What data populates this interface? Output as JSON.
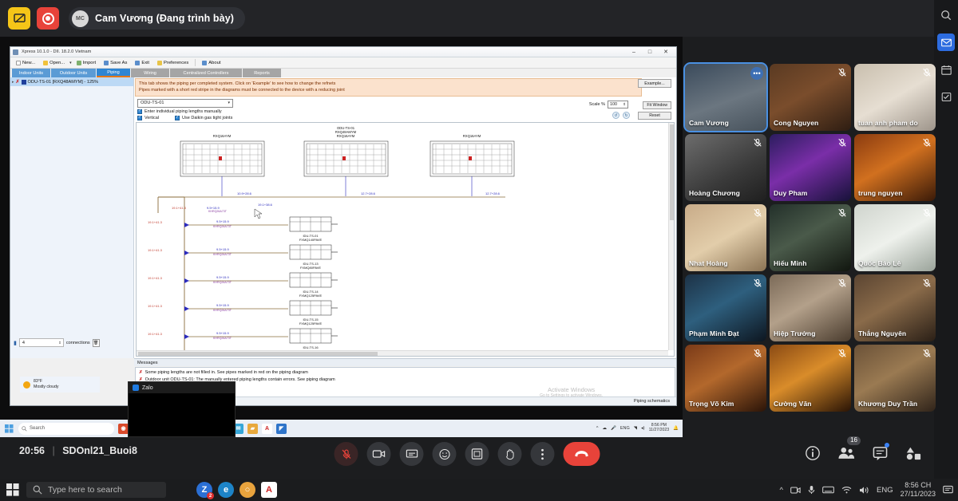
{
  "meeting": {
    "presenter_label": "Cam Vương (Đang trình bày)",
    "presenter_avatar": "MC",
    "share_icon": "screen-share-icon",
    "record_icon": "record-icon",
    "elapsed_time": "20:56",
    "room_name": "SDOnl21_Buoi8",
    "separator": "|",
    "participant_count": "16"
  },
  "controls": [
    {
      "name": "mic-toggle",
      "icon": "microphone-muted-icon"
    },
    {
      "name": "camera-toggle",
      "icon": "camera-icon"
    },
    {
      "name": "present-screen",
      "icon": "present-icon"
    },
    {
      "name": "reactions",
      "icon": "emoji-icon"
    },
    {
      "name": "layout",
      "icon": "layout-icon"
    },
    {
      "name": "raise-hand",
      "icon": "hand-icon"
    },
    {
      "name": "more-options",
      "icon": "more-vertical-icon"
    },
    {
      "name": "end-call",
      "icon": "phone-hangup-icon"
    }
  ],
  "right_controls": [
    {
      "name": "meeting-info",
      "icon": "info-icon"
    },
    {
      "name": "participants",
      "icon": "people-icon",
      "badge": "16"
    },
    {
      "name": "chat",
      "icon": "chat-icon",
      "dot": true
    },
    {
      "name": "apps",
      "icon": "shapes-icon"
    }
  ],
  "right_rail": [
    {
      "name": "search-icon"
    },
    {
      "name": "mail-icon"
    },
    {
      "name": "calendar-icon"
    },
    {
      "name": "tasks-icon"
    }
  ],
  "participants": [
    {
      "name": "Cam Vương",
      "muted": false,
      "speaking": true,
      "dots": true,
      "bg": "linear-gradient(160deg,#3b4b5c,#6b7680 55%,#47525c)"
    },
    {
      "name": "Cong Nguyen",
      "muted": true,
      "speaking": false,
      "dots": false,
      "bg": "linear-gradient(150deg,#5a3a22,#7a4d2c 45%,#2e1d12)"
    },
    {
      "name": "tuan anh pham do",
      "muted": true,
      "speaking": false,
      "dots": false,
      "bg": "linear-gradient(150deg,#c9bfae,#e6ded2 50%,#9d948a)"
    },
    {
      "name": "Hoàng Chương",
      "muted": true,
      "speaking": false,
      "dots": false,
      "bg": "linear-gradient(150deg,#6d6d6d,#3a3a3a 60%,#1f1f1f)"
    },
    {
      "name": "Duy Pham",
      "muted": true,
      "speaking": false,
      "dots": false,
      "bg": "linear-gradient(150deg,#2b1d5e,#7a2ea8 45%,#17123a)"
    },
    {
      "name": "trung nguyen",
      "muted": true,
      "speaking": false,
      "dots": false,
      "bg": "linear-gradient(150deg,#8a3b10,#d1701f 45%,#3a1a08)"
    },
    {
      "name": "Nhat Hoàng",
      "muted": true,
      "speaking": false,
      "dots": false,
      "bg": "linear-gradient(150deg,#c8ab88,#e2cdaa 50%,#8b7354)"
    },
    {
      "name": "Hiếu Minh",
      "muted": true,
      "speaking": false,
      "dots": false,
      "bg": "linear-gradient(150deg,#23302a,#4a5a4a 45%,#11160f)"
    },
    {
      "name": "Quốc Bảo Lê",
      "muted": true,
      "speaking": false,
      "dots": false,
      "bg": "linear-gradient(150deg,#cfd4cd,#eef1ec 50%,#9aa39a)"
    },
    {
      "name": "Phạm Minh Đạt",
      "muted": true,
      "speaking": false,
      "dots": false,
      "bg": "linear-gradient(150deg,#1d3246,#2e5f7e 45%,#0d1620)"
    },
    {
      "name": "Hiệp Trưởng",
      "muted": true,
      "speaking": false,
      "dots": false,
      "bg": "linear-gradient(150deg,#7b6a58,#b3a08a 45%,#4a3c2e)"
    },
    {
      "name": "Thắng Nguyên",
      "muted": true,
      "speaking": false,
      "dots": false,
      "bg": "linear-gradient(150deg,#5b4532,#8a6b4a 45%,#2a1f16)"
    },
    {
      "name": "Trọng Võ Kim",
      "muted": true,
      "speaking": false,
      "dots": false,
      "bg": "linear-gradient(150deg,#7a3a18,#b3682c 45%,#2b1408)"
    },
    {
      "name": "Cường Văn",
      "muted": true,
      "speaking": false,
      "dots": false,
      "bg": "linear-gradient(150deg,#8a4a14,#d98c2a 45%,#2a1405)"
    },
    {
      "name": "Khương Duy Trần",
      "muted": true,
      "speaking": false,
      "dots": false,
      "bg": "linear-gradient(150deg,#6b5238,#9a7a52 45%,#30241a)"
    }
  ],
  "shared_app": {
    "window_title": "Xpress 10.1.0 - DII. 18.2.0 Vietnam",
    "window_controls": {
      "minimize": "–",
      "maximize": "□",
      "close": "✕"
    },
    "toolbar": [
      {
        "label": "New...",
        "icon": "new-file-icon"
      },
      {
        "label": "Open...",
        "icon": "open-folder-icon"
      },
      {
        "label": "Import",
        "icon": "import-icon"
      },
      {
        "label": "Save As",
        "icon": "save-icon"
      },
      {
        "label": "Exit",
        "icon": "exit-icon"
      },
      {
        "label": "Preferences",
        "icon": "preferences-star-icon"
      },
      {
        "label": "About",
        "icon": "about-icon"
      }
    ],
    "tabs": [
      {
        "label": "Indoor Units",
        "active": false
      },
      {
        "label": "Outdoor Units",
        "active": false
      },
      {
        "label": "Piping",
        "active": true
      },
      {
        "label": "Wiring",
        "active": false,
        "gray": true
      },
      {
        "label": "Centralized Controllers",
        "active": false,
        "gray": true
      },
      {
        "label": "Reports",
        "active": false,
        "gray": true
      }
    ],
    "tree": {
      "item_label": "ODU-TS-01 [RXQ48AMYM] - 125%",
      "connections_value": "4",
      "connections_label": "connections",
      "delete_icon": "trash-icon"
    },
    "notice_line1": "This tab shows the piping per completed system. Click on 'Example' to see how to change the refnets",
    "notice_line2": "Pipes marked with a short red stripe in the diagrams must be connected to the device with a reducing joint",
    "example_button": "Example...",
    "system_select": "ODU-TS-01",
    "scale_label": "Scale %",
    "scale_value": "100",
    "fit_window_button": "Fit Window",
    "reset_button": "Reset",
    "checkboxes": [
      {
        "label": "Enter individual piping lengths manually",
        "checked": true
      },
      {
        "label": "Vertical",
        "checked": true
      },
      {
        "label": "Use Daikin gas tight joints",
        "checked": true
      }
    ],
    "messages_header": "Messages",
    "messages": [
      "Some piping lengths are not filled in. See pipes marked in red on the piping diagram",
      "Outdoor unit ODU-TS-01: The manually entered piping lengths contain errors. See piping diagram"
    ],
    "status_bar": "Piping schematics",
    "activate_windows": {
      "line1": "Activate Windows",
      "line2": "Go to Settings to activate Windows."
    },
    "weather": {
      "temp": "83°F",
      "desc": "Mostly cloudy"
    },
    "diagram": {
      "odu_header": [
        "ODU-TS-01",
        "RXQ48AMYM",
        "RXQ16AYM"
      ],
      "odu_units": [
        "RXQ16AYM",
        "RXQ16AYM",
        "RXQ16AYM"
      ],
      "trunk_dims": [
        "10.9+28.6",
        "12.7+28.6",
        "12.7+28.6"
      ],
      "branch_dims": [
        "19.1+38.6",
        "19.1+41.3",
        "9.5+15.9"
      ],
      "refnet_label": "KHRQ26A73T",
      "indoor_units": [
        {
          "tag": "IDU-TS-01",
          "model": "FXMQ140PAVE",
          "dim_left": "19.1+41.3",
          "dim_right": "9.5+15.9",
          "refnet": "KHRQ26A73T"
        },
        {
          "tag": "IDU-TS-13",
          "model": "FXMQ80PAVE",
          "dim_left": "19.1+41.3",
          "dim_right": "9.5+15.9",
          "refnet": "KHRQ26A73T"
        },
        {
          "tag": "IDU-TS-14",
          "model": "FXMQ125PAVE",
          "dim_left": "19.1+41.3",
          "dim_right": "9.5+15.9",
          "refnet": "KHRQ26A73T"
        },
        {
          "tag": "IDU-TS-15",
          "model": "FXMQ125PAVE",
          "dim_left": "19.1+41.3",
          "dim_right": "9.5+15.9",
          "refnet": "KHRQ26A73T"
        },
        {
          "tag": "IDU-TS-16",
          "model": "FXMQ125PAVE",
          "dim_left": "19.1+41.3",
          "dim_right": "9.5+15.9",
          "refnet": "KHRQ26A73T"
        }
      ]
    },
    "inner_taskbar": {
      "search_placeholder": "Search",
      "language": "ENG",
      "time": "8:56 PM",
      "date": "11/27/2023"
    },
    "zalo_window": {
      "title": "Zalo",
      "icon": "zalo-icon"
    }
  },
  "os_taskbar": {
    "start_icon": "windows-start-icon",
    "search_placeholder": "Type here to search",
    "apps": [
      {
        "name": "zalo-taskbar-icon",
        "glyph": "Z",
        "color": "#2b6fd4",
        "badge": "2"
      },
      {
        "name": "edge-taskbar-icon",
        "glyph": "e",
        "color": "#1d84c8",
        "badge": ""
      },
      {
        "name": "chrome-taskbar-icon",
        "glyph": "○",
        "color": "#e8a33d",
        "badge": ""
      },
      {
        "name": "autocad-taskbar-icon",
        "glyph": "A",
        "color": "#ffffff",
        "badge": ""
      }
    ],
    "tray": {
      "chevron": "^",
      "icons": [
        "camera-tray-icon",
        "microphone-tray-icon",
        "keyboard-tray-icon",
        "wifi-tray-icon",
        "volume-tray-icon"
      ],
      "language": "ENG",
      "time": "8:56 CH",
      "date": "27/11/2023",
      "notification_icon": "notification-icon"
    }
  }
}
